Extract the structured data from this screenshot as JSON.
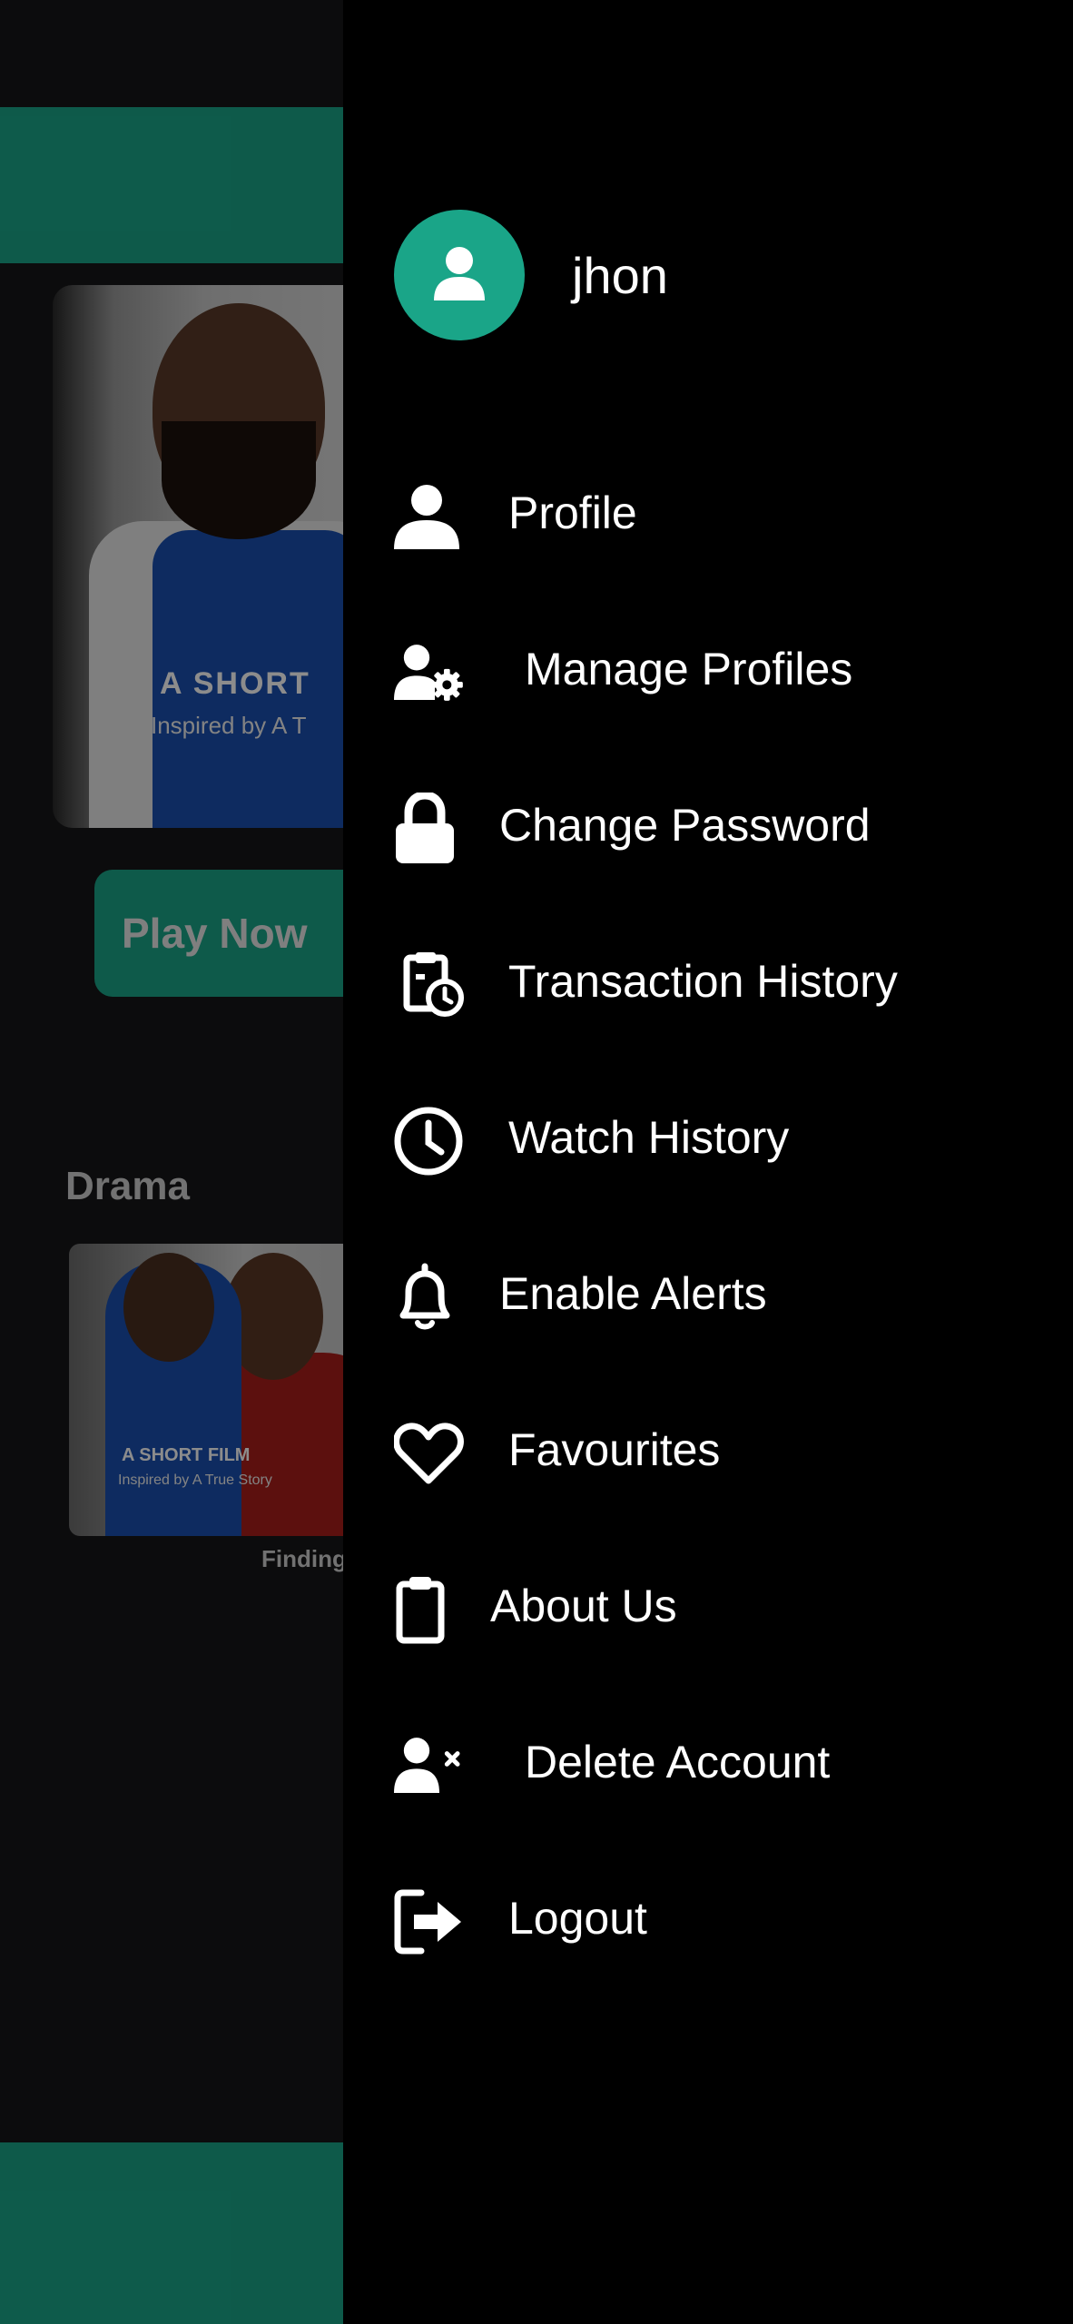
{
  "background": {
    "hero": {
      "title": "A SHORT",
      "subtitle": "Inspired by A T"
    },
    "play_button_label": "Play Now",
    "section_title": "Drama",
    "card": {
      "title": "A SHORT FILM",
      "subtitle": "Inspired by A True Story",
      "caption": "Finding"
    }
  },
  "drawer": {
    "username": "jhon",
    "avatar_icon": "user-icon",
    "accent_color": "#1aa588",
    "items": [
      {
        "label": "Profile",
        "icon": "user-icon"
      },
      {
        "label": "Manage Profiles",
        "icon": "user-gear-icon"
      },
      {
        "label": "Change Password",
        "icon": "lock-icon"
      },
      {
        "label": "Transaction History",
        "icon": "clipboard-clock-icon"
      },
      {
        "label": "Watch History",
        "icon": "clock-icon"
      },
      {
        "label": "Enable Alerts",
        "icon": "bell-icon"
      },
      {
        "label": "Favourites",
        "icon": "heart-icon"
      },
      {
        "label": "About Us",
        "icon": "clipboard-icon"
      },
      {
        "label": "Delete Account",
        "icon": "user-xmark-icon"
      },
      {
        "label": "Logout",
        "icon": "logout-icon"
      }
    ]
  }
}
